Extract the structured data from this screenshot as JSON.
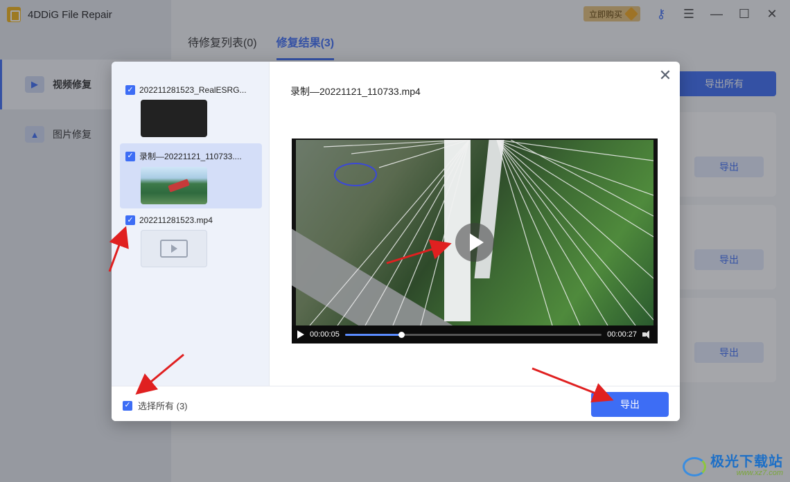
{
  "app": {
    "title": "4DDiG File Repair"
  },
  "topbar": {
    "buy_label": "立即购买"
  },
  "sidebar": {
    "items": [
      {
        "label": "视频修复",
        "active": true
      },
      {
        "label": "图片修复",
        "active": false
      }
    ]
  },
  "main": {
    "tabs": [
      {
        "label": "待修复列表(0)",
        "active": false
      },
      {
        "label": "修复结果(3)",
        "active": true
      }
    ],
    "export_all_label": "导出所有",
    "card_export_label": "导出"
  },
  "modal": {
    "files": [
      {
        "name": "202211281523_RealESRG...",
        "checked": true,
        "thumb": "dark"
      },
      {
        "name": "录制—20221121_110733....",
        "checked": true,
        "thumb": "scene",
        "selected": true
      },
      {
        "name": "202211281523.mp4",
        "checked": true,
        "thumb": "film-icon"
      }
    ],
    "preview_title": "录制—20221121_110733.mp4",
    "player": {
      "current_time": "00:00:05",
      "total_time": "00:00:27",
      "progress_fraction": 0.22
    },
    "select_all_label": "选择所有 (3)",
    "export_label": "导出",
    "close_icon": "close-icon"
  },
  "watermark": {
    "main": "极光下载站",
    "sub": "www.xz7.com"
  },
  "colors": {
    "accent": "#3d6df5",
    "annotation": "#e02020"
  }
}
